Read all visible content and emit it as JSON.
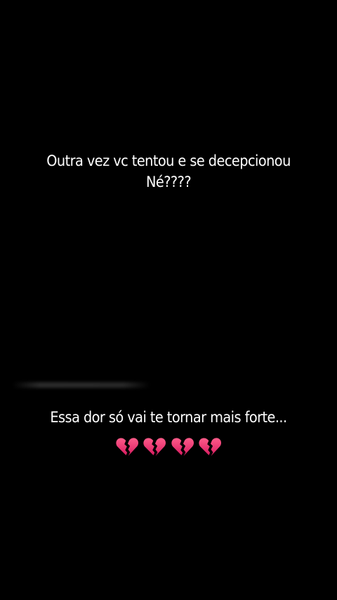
{
  "story": {
    "top_text": {
      "line1": "Outra vez vc tentou e se decepcionou",
      "line2": "Né????"
    },
    "bottom_text": {
      "line1": "Essa dor só vai te tornar mais forte..."
    },
    "hearts": [
      "broken-heart-icon",
      "broken-heart-icon",
      "broken-heart-icon",
      "broken-heart-icon"
    ]
  },
  "colors": {
    "background": "#000000",
    "text": "#ffffff",
    "heart": "#e0245e"
  }
}
